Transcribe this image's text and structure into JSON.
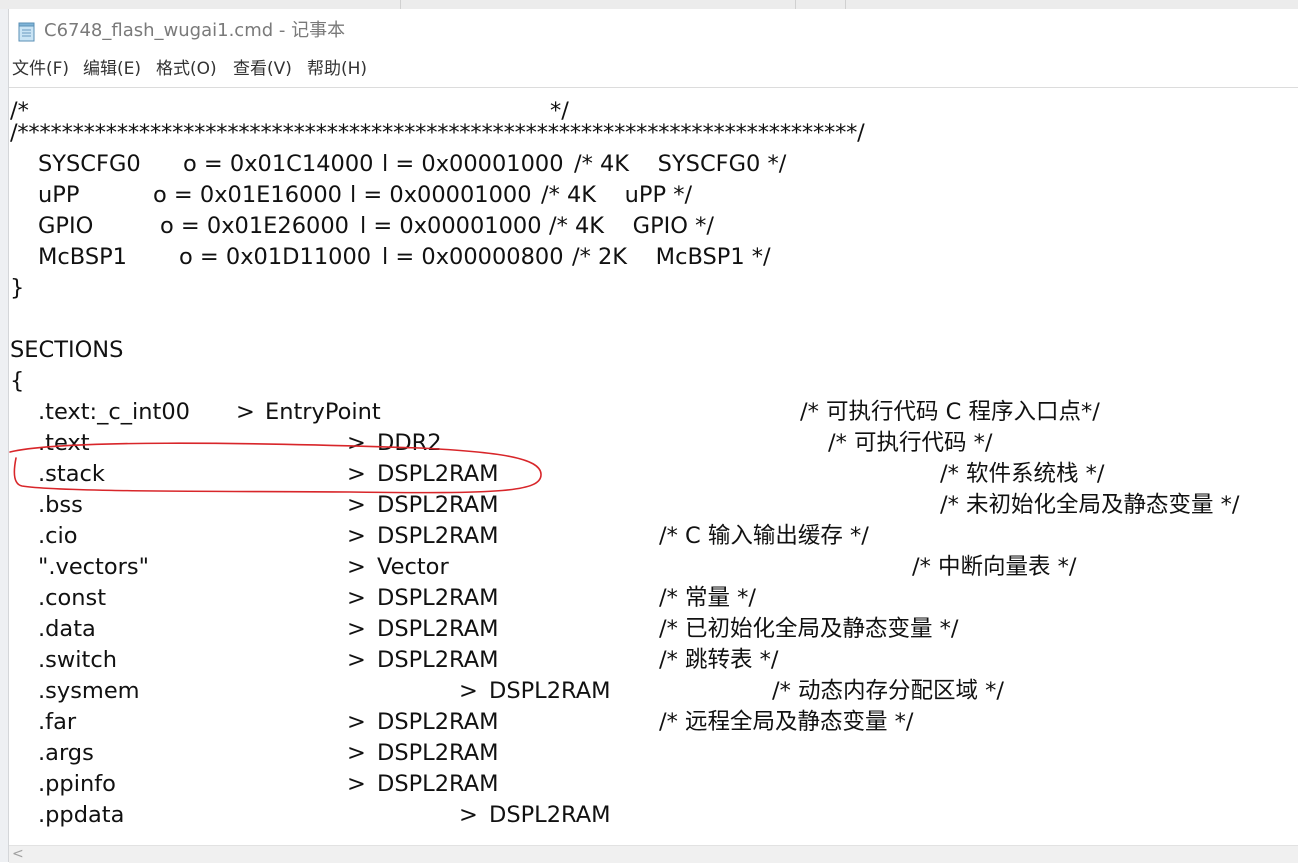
{
  "window": {
    "title": "C6748_flash_wugai1.cmd - 记事本"
  },
  "menu": [
    {
      "label": "文件(F)"
    },
    {
      "label": "编辑(E)"
    },
    {
      "label": "格式(O)"
    },
    {
      "label": "查看(V)"
    },
    {
      "label": "帮助(H)"
    }
  ],
  "editor": {
    "comment_open": {
      "begin": "/*",
      "end": "*/"
    },
    "stars_line": "/****************************************************************************/",
    "memory": [
      {
        "name": "SYSCFG0",
        "origin": "o = 0x01C14000",
        "length": "l = 0x00001000",
        "comment": "/* 4K    SYSCFG0 */"
      },
      {
        "name": "uPP",
        "origin": "o = 0x01E16000",
        "length": "l = 0x00001000",
        "comment": "/* 4K    uPP */"
      },
      {
        "name": "GPIO",
        "origin": "o = 0x01E26000",
        "length": "l = 0x00001000",
        "comment": "/* 4K    GPIO */"
      },
      {
        "name": "McBSP1",
        "origin": "o = 0x01D11000",
        "length": "l = 0x00000800",
        "comment": "/* 2K    McBSP1 */"
      }
    ],
    "close_brace": "}",
    "sections_keyword": "SECTIONS",
    "open_brace": "{",
    "sections": [
      {
        "name": ".text:_c_int00",
        "arrow": ">",
        "target": "EntryPoint",
        "comment": "/* 可执行代码 C 程序入口点*/"
      },
      {
        "name": ".text",
        "arrow": ">",
        "target": "DDR2",
        "comment": "/* 可执行代码 */"
      },
      {
        "name": ".stack",
        "arrow": ">",
        "target": "DSPL2RAM",
        "comment": "/* 软件系统栈 */"
      },
      {
        "name": ".bss",
        "arrow": ">",
        "target": "DSPL2RAM",
        "comment": "/* 未初始化全局及静态变量 */"
      },
      {
        "name": ".cio",
        "arrow": ">",
        "target": "DSPL2RAM",
        "comment": "/* C 输入输出缓存 */"
      },
      {
        "name": "\".vectors\"",
        "arrow": ">",
        "target": "Vector",
        "comment": "/* 中断向量表 */"
      },
      {
        "name": ".const",
        "arrow": ">",
        "target": "DSPL2RAM",
        "comment": "/* 常量 */"
      },
      {
        "name": ".data",
        "arrow": ">",
        "target": "DSPL2RAM",
        "comment": "/* 已初始化全局及静态变量 */"
      },
      {
        "name": ".switch",
        "arrow": ">",
        "target": "DSPL2RAM",
        "comment": "/* 跳转表 */"
      },
      {
        "name": ".sysmem",
        "arrow": ">",
        "target": "DSPL2RAM",
        "comment": "/* 动态内存分配区域 */"
      },
      {
        "name": ".far",
        "arrow": ">",
        "target": "DSPL2RAM",
        "comment": "/* 远程全局及静态变量 */"
      },
      {
        "name": ".args",
        "arrow": ">",
        "target": "DSPL2RAM",
        "comment": ""
      },
      {
        "name": ".ppinfo",
        "arrow": ">",
        "target": "DSPL2RAM",
        "comment": ""
      },
      {
        "name": ".ppdata",
        "arrow": ">",
        "target": "DSPL2RAM",
        "comment": ""
      }
    ]
  },
  "scrollbar": {
    "left_arrow": "<"
  },
  "colors": {
    "annotation": "#d8262a",
    "title_text": "#7a7a7a"
  }
}
